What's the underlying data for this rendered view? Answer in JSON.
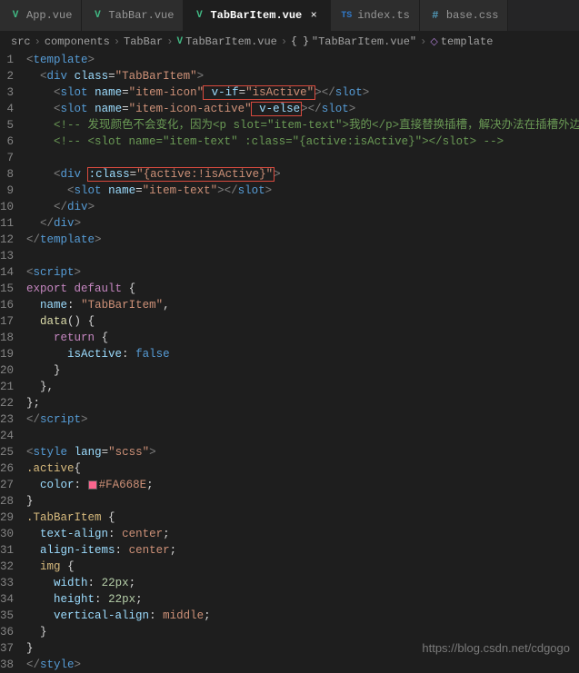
{
  "tabs": [
    {
      "label": "App.vue",
      "iconType": "vue",
      "active": false
    },
    {
      "label": "TabBar.vue",
      "iconType": "vue",
      "active": false
    },
    {
      "label": "TabBarItem.vue",
      "iconType": "vue",
      "active": true
    },
    {
      "label": "index.ts",
      "iconType": "ts",
      "active": false
    },
    {
      "label": "base.css",
      "iconType": "css",
      "active": false
    }
  ],
  "breadcrumbs": {
    "parts": [
      "src",
      "components",
      "TabBar",
      "TabBarItem.vue",
      "\"TabBarItem.vue\"",
      "template"
    ]
  },
  "code": {
    "lines": [
      "<template>",
      "  <div class=\"TabBarItem\">",
      "    <slot name=\"item-icon\" v-if=\"isActive\"></slot>",
      "    <slot name=\"item-icon-active\" v-else></slot>",
      "    <!-- 发现颜色不会变化，因为<p slot=\"item-text\">我的</p>直接替换插槽，解决办法在插槽外边",
      "    <!-- <slot name=\"item-text\" :class=\"{active:isActive}\"></slot> -->",
      "",
      "    <div :class=\"{active:!isActive}\">",
      "      <slot name=\"item-text\"></slot>",
      "    </div>",
      "  </div>",
      "</template>",
      "",
      "<script>",
      "export default {",
      "  name: \"TabBarItem\",",
      "  data() {",
      "    return {",
      "      isActive: false",
      "    }",
      "  },",
      "};",
      "</script>",
      "",
      "<style lang=\"scss\">",
      ".active{",
      "  color: #FA668E;",
      "}",
      ".TabBarItem {",
      "  text-align: center;",
      "  align-items: center;",
      "  img {",
      "    width: 22px;",
      "    height: 22px;",
      "    vertical-align: middle;",
      "  }",
      "}",
      "</style>"
    ]
  },
  "watermark": "https://blog.csdn.net/cdgogo",
  "closeGlyph": "×",
  "colorHex": "#FA668E"
}
